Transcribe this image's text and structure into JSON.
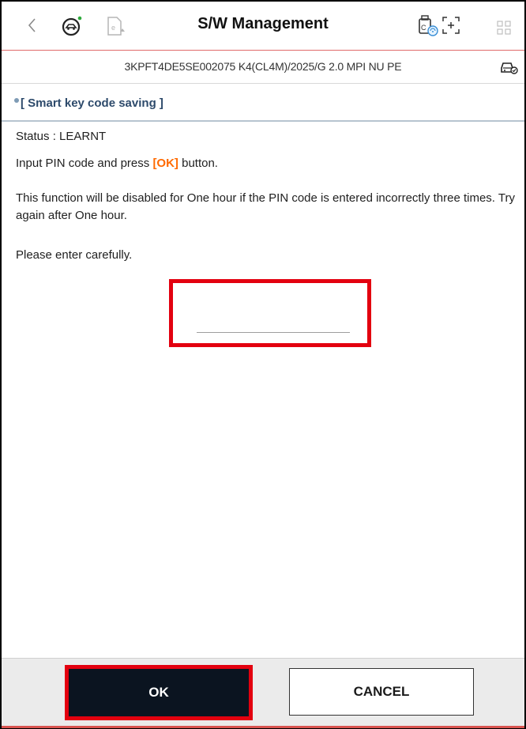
{
  "header": {
    "title": "S/W Management",
    "icons": {
      "back": "chevron-left-icon",
      "diagnosis": "car-diagnosis-icon",
      "ecu": "ecu-upgrade-icon",
      "vci": "vci-connection-icon",
      "capture": "screen-capture-icon",
      "grid": "grid-menu-icon"
    }
  },
  "vehicle": {
    "info": "3KPFT4DE5SE002075  K4(CL4M)/2025/G 2.0 MPI NU PE",
    "icon": "vehicle-status-icon"
  },
  "section": {
    "title": "[ Smart key code saving ]"
  },
  "content": {
    "status": "Status : LEARNT",
    "instruction_prefix": "Input PIN code and press ",
    "instruction_ok": "[OK]",
    "instruction_suffix": " button.",
    "warning": "This function will be disabled for One hour if the PIN code is entered incorrectly three times. Try again after One hour.",
    "careful": "Please enter carefully."
  },
  "pin_input": {
    "value": "",
    "placeholder": ""
  },
  "footer": {
    "ok_label": "OK",
    "cancel_label": "CANCEL"
  },
  "colors": {
    "accent_orange": "#ff6a00",
    "highlight_red": "#e3000f",
    "section_title": "#2d4a6b",
    "ok_button_bg": "#0b1420"
  }
}
